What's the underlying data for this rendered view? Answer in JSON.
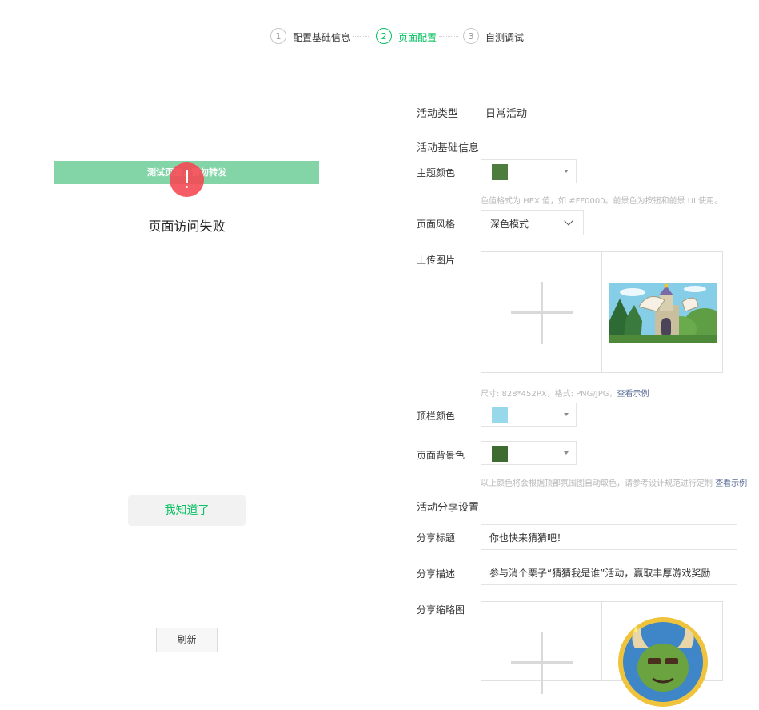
{
  "steps": [
    {
      "num": "1",
      "label": "配置基础信息"
    },
    {
      "num": "2",
      "label": "页面配置"
    },
    {
      "num": "3",
      "label": "自测调试"
    }
  ],
  "colors": {
    "accent": "#07c160",
    "link": "#576b95",
    "banner": "#83d5a8",
    "error": "#f54650"
  },
  "preview": {
    "banner_text": "测试页面，请勿转发",
    "fail_title": "页面访问失败",
    "know_button": "我知道了",
    "refresh_button": "刷新"
  },
  "form": {
    "activity_type_label": "活动类型",
    "activity_type_value": "日常活动",
    "basic_section": "活动基础信息",
    "theme_color_label": "主题颜色",
    "theme_color_value": "#4e7c3d",
    "theme_color_hint": "色值格式为 HEX 值，如 #FF0000。前景色为按钮和前景 UI 使用。",
    "style_label": "页面风格",
    "style_value": "深色模式",
    "upload_label": "上传图片",
    "upload_hint": "尺寸: 828*452PX，格式: PNG/JPG，",
    "upload_hint_link": "查看示例",
    "topbar_color_label": "顶栏颜色",
    "topbar_color_value": "#97d8ea",
    "bg_color_label": "页面背景色",
    "bg_color_value": "#3f6b30",
    "bg_color_hint": "以上颜色将会根据顶部氛围图自动取色，请参考设计规范进行定制",
    "bg_color_hint_link": "查看示例",
    "share_section": "活动分享设置",
    "share_title_label": "分享标题",
    "share_title_value": "你也快来猜猜吧！",
    "share_desc_label": "分享描述",
    "share_desc_value": "参与消个栗子“猜猜我是谁”活动，赢取丰厚游戏奖励",
    "share_thumb_label": "分享缩略图"
  },
  "icons": {
    "add": "plus-icon",
    "dropdown": "caret-down-icon",
    "alert": "exclamation-icon"
  }
}
